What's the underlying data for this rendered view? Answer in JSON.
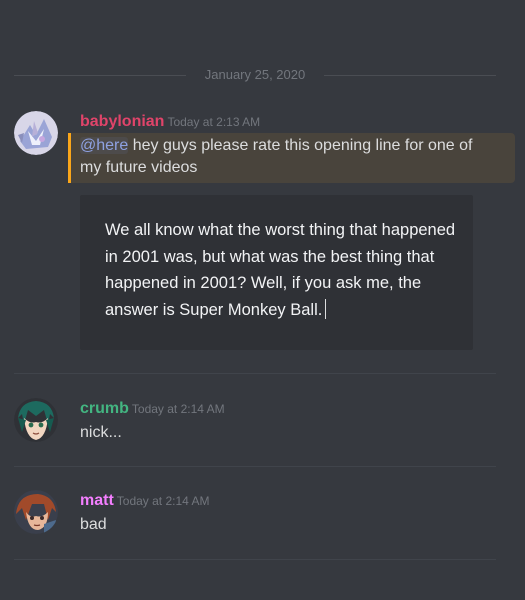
{
  "divider": {
    "date": "January 25, 2020"
  },
  "messages": [
    {
      "username": "babylonian",
      "username_color": "#e0446a",
      "timestamp": "Today at 2:13 AM",
      "mention": "@here",
      "text": " hey guys please rate this opening line for one of my future videos",
      "embed_text": "We all know what the worst thing that happened in 2001 was, but what was the best thing that happened in 2001? Well, if you ask me, the answer is Super Monkey Ball."
    },
    {
      "username": "crumb",
      "username_color": "#43b581",
      "timestamp": "Today at 2:14 AM",
      "text": "nick..."
    },
    {
      "username": "matt",
      "username_color": "#f47fff",
      "timestamp": "Today at 2:14 AM",
      "text": "bad"
    }
  ],
  "colors": {
    "background": "#36393f",
    "mention_highlight": "#49443c",
    "mention_bar": "#faa61a",
    "embed_background": "#2f3136"
  }
}
